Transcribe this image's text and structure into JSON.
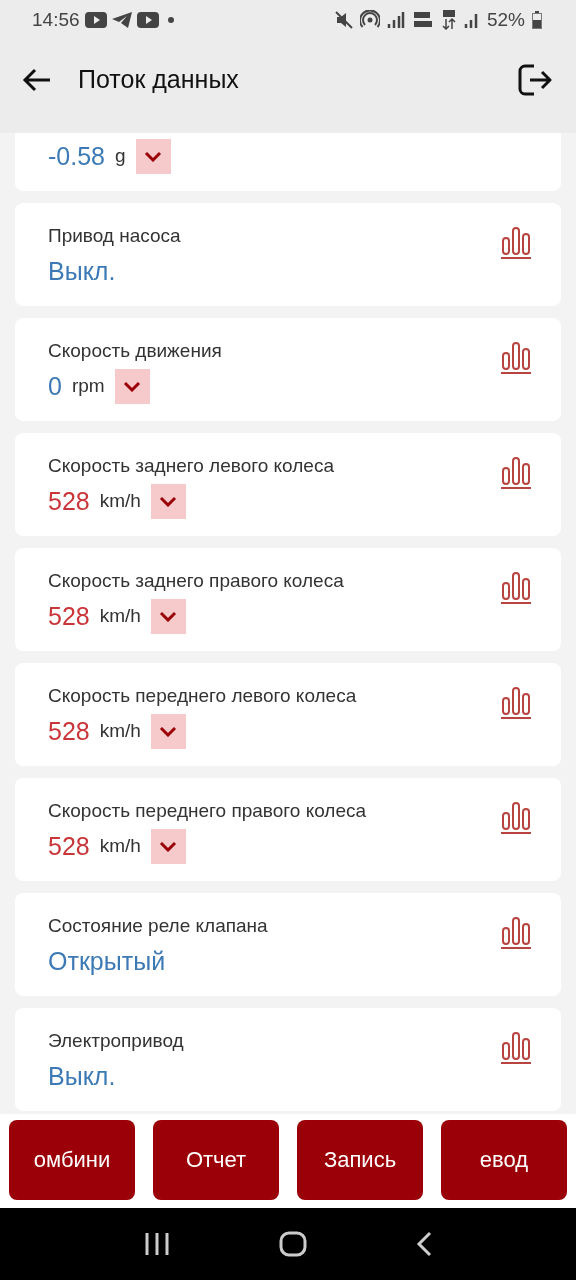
{
  "status_bar": {
    "time": "14:56",
    "battery": "52%"
  },
  "app_bar": {
    "title": "Поток данных"
  },
  "items": [
    {
      "value": "-0.58",
      "unit": "g",
      "color": "#3d7ab5"
    },
    {
      "label": "Привод насоса",
      "value": "Выкл.",
      "color": "#3d7ab5"
    },
    {
      "label": "Скорость движения",
      "value": "0",
      "unit": "rpm",
      "color": "#3d7ab5"
    },
    {
      "label": "Скорость заднего левого колеса",
      "value": "528",
      "unit": "km/h",
      "color": "#c9363a"
    },
    {
      "label": "Скорость заднего правого колеса",
      "value": "528",
      "unit": "km/h",
      "color": "#c9363a"
    },
    {
      "label": "Скорость переднего левого колеса",
      "value": "528",
      "unit": "km/h",
      "color": "#c9363a"
    },
    {
      "label": "Скорость переднего правого колеса",
      "value": "528",
      "unit": "km/h",
      "color": "#c9363a"
    },
    {
      "label": "Состояние реле клапана",
      "value": "Открытый",
      "color": "#3d7ab5"
    },
    {
      "label": "Электропривод",
      "value": "Выкл.",
      "color": "#3d7ab5"
    }
  ],
  "buttons": [
    "омбини",
    "Отчет",
    "Запись",
    "евод"
  ]
}
